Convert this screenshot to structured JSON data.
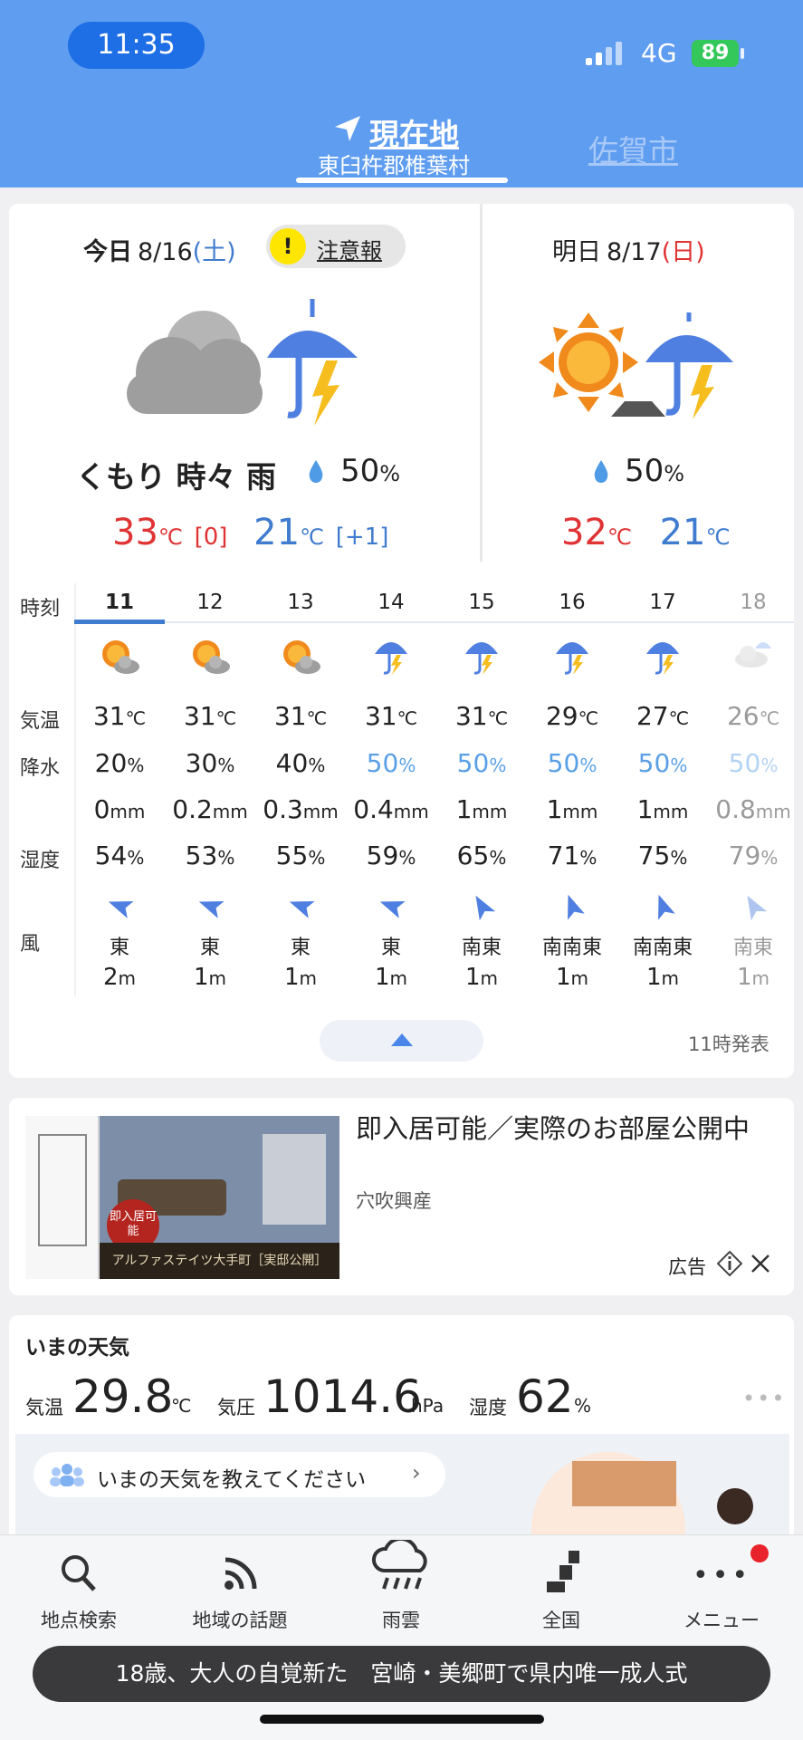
{
  "status_bar": {
    "time": "11:35",
    "network": "4G",
    "battery": "89"
  },
  "header": {
    "current_label": "現在地",
    "current_location": "東臼杵郡椎葉村",
    "other_location": "佐賀市"
  },
  "today": {
    "label": "今日",
    "date": "8/16",
    "weekday": "(土)",
    "alert_icon": "!",
    "alert": "注意報",
    "condition": "くもり 時々 雨",
    "pop": "50",
    "pop_unit": "%",
    "high": "33",
    "high_diff": "[0]",
    "low": "21",
    "low_diff": "[+1]",
    "temp_unit": "℃"
  },
  "tomorrow": {
    "label": "明日",
    "date": "8/17",
    "weekday": "(日)",
    "pop": "50",
    "pop_unit": "%",
    "high": "32",
    "low": "21",
    "temp_unit": "℃"
  },
  "hourly": {
    "labels": {
      "time": "時刻",
      "temp": "気温",
      "precip_prob": "降水",
      "humidity": "湿度",
      "wind": "風"
    },
    "hours": [
      {
        "h": "11",
        "icon": "sun-cloud-icon",
        "temp": "31",
        "pop": "20",
        "mm": "0",
        "hum": "54",
        "dir": "東",
        "speed": "2"
      },
      {
        "h": "12",
        "icon": "sun-cloud-icon",
        "temp": "31",
        "pop": "30",
        "mm": "0.2",
        "hum": "53",
        "dir": "東",
        "speed": "1"
      },
      {
        "h": "13",
        "icon": "sun-cloud-icon",
        "temp": "31",
        "pop": "40",
        "mm": "0.3",
        "hum": "55",
        "dir": "東",
        "speed": "1"
      },
      {
        "h": "14",
        "icon": "umbrella-thunder-icon",
        "temp": "31",
        "pop": "50",
        "mm": "0.4",
        "hum": "59",
        "dir": "東",
        "speed": "1"
      },
      {
        "h": "15",
        "icon": "umbrella-thunder-icon",
        "temp": "31",
        "pop": "50",
        "mm": "1",
        "hum": "65",
        "dir": "南東",
        "speed": "1"
      },
      {
        "h": "16",
        "icon": "umbrella-thunder-icon",
        "temp": "29",
        "pop": "50",
        "mm": "1",
        "hum": "71",
        "dir": "南南東",
        "speed": "1"
      },
      {
        "h": "17",
        "icon": "umbrella-thunder-icon",
        "temp": "27",
        "pop": "50",
        "mm": "1",
        "hum": "75",
        "dir": "南南東",
        "speed": "1"
      },
      {
        "h": "18",
        "icon": "cloud-rain-icon",
        "temp": "26",
        "pop": "50",
        "mm": "0.8",
        "hum": "79",
        "dir": "南東",
        "speed": "1"
      }
    ],
    "units": {
      "temp": "℃",
      "pop": "%",
      "mm": "mm",
      "hum": "%",
      "speed": "m"
    },
    "issued": "11時発表"
  },
  "ad": {
    "title": "即入居可能／実際のお部屋公開中",
    "company": "穴吹興産",
    "label": "広告",
    "image_caption": "アルファステイツ大手町［実邸公開］",
    "badge": "即入居可能"
  },
  "now": {
    "title": "いまの天気",
    "temp_label": "気温",
    "temp": "29.8",
    "temp_unit": "℃",
    "pressure_label": "気圧",
    "pressure": "1014.6",
    "pressure_unit": "hPa",
    "humidity_label": "湿度",
    "humidity": "62",
    "humidity_unit": "%",
    "share_prompt": "いまの天気を教えてください"
  },
  "nav": {
    "search": "地点検索",
    "topics": "地域の話題",
    "rain": "雨雲",
    "national": "全国",
    "menu": "メニュー"
  },
  "ticker": "18歳、大人の自覚新た　宮崎・美郷町で県内唯一成人式",
  "colors": {
    "header": "#5f9df0",
    "high_temp": "#e03333",
    "low_temp": "#3f7ccf",
    "accent": "#1e6ee6"
  }
}
